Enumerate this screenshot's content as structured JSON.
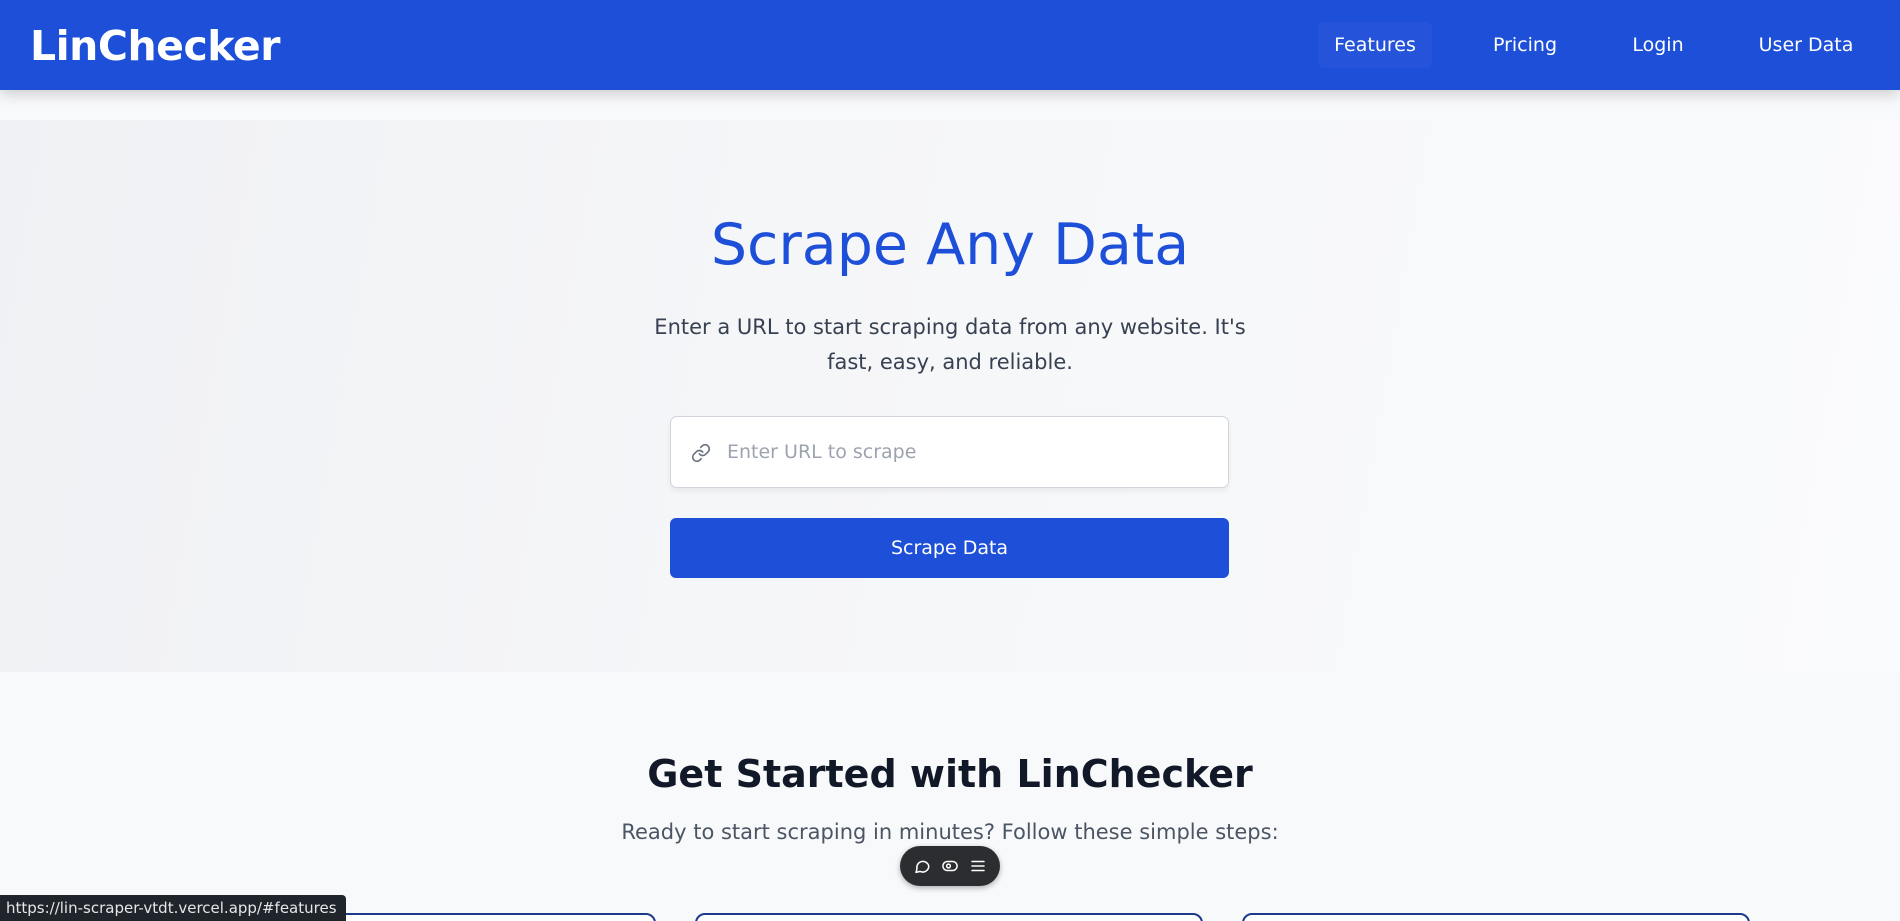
{
  "navbar": {
    "brand": "LinChecker",
    "items": [
      {
        "label": "Features"
      },
      {
        "label": "Pricing"
      },
      {
        "label": "Login"
      },
      {
        "label": "User Data"
      }
    ]
  },
  "hero": {
    "title": "Scrape Any Data",
    "subtitle": "Enter a URL to start scraping data from any website. It's fast, easy, and reliable.",
    "url_input": {
      "placeholder": "Enter URL to scrape",
      "value": ""
    },
    "button_label": "Scrape Data"
  },
  "get_started": {
    "title": "Get Started with LinChecker",
    "subtitle": "Ready to start scraping in minutes? Follow these simple steps:"
  },
  "floating_toolbar": {
    "icons": [
      "chat-icon",
      "eye-icon",
      "menu-icon"
    ]
  },
  "status_bar": {
    "url": "https://lin-scraper-vtdt.vercel.app/#features"
  },
  "colors": {
    "primary": "#1d4fd8",
    "card_border": "#1e3a8a",
    "heading": "#111827"
  }
}
